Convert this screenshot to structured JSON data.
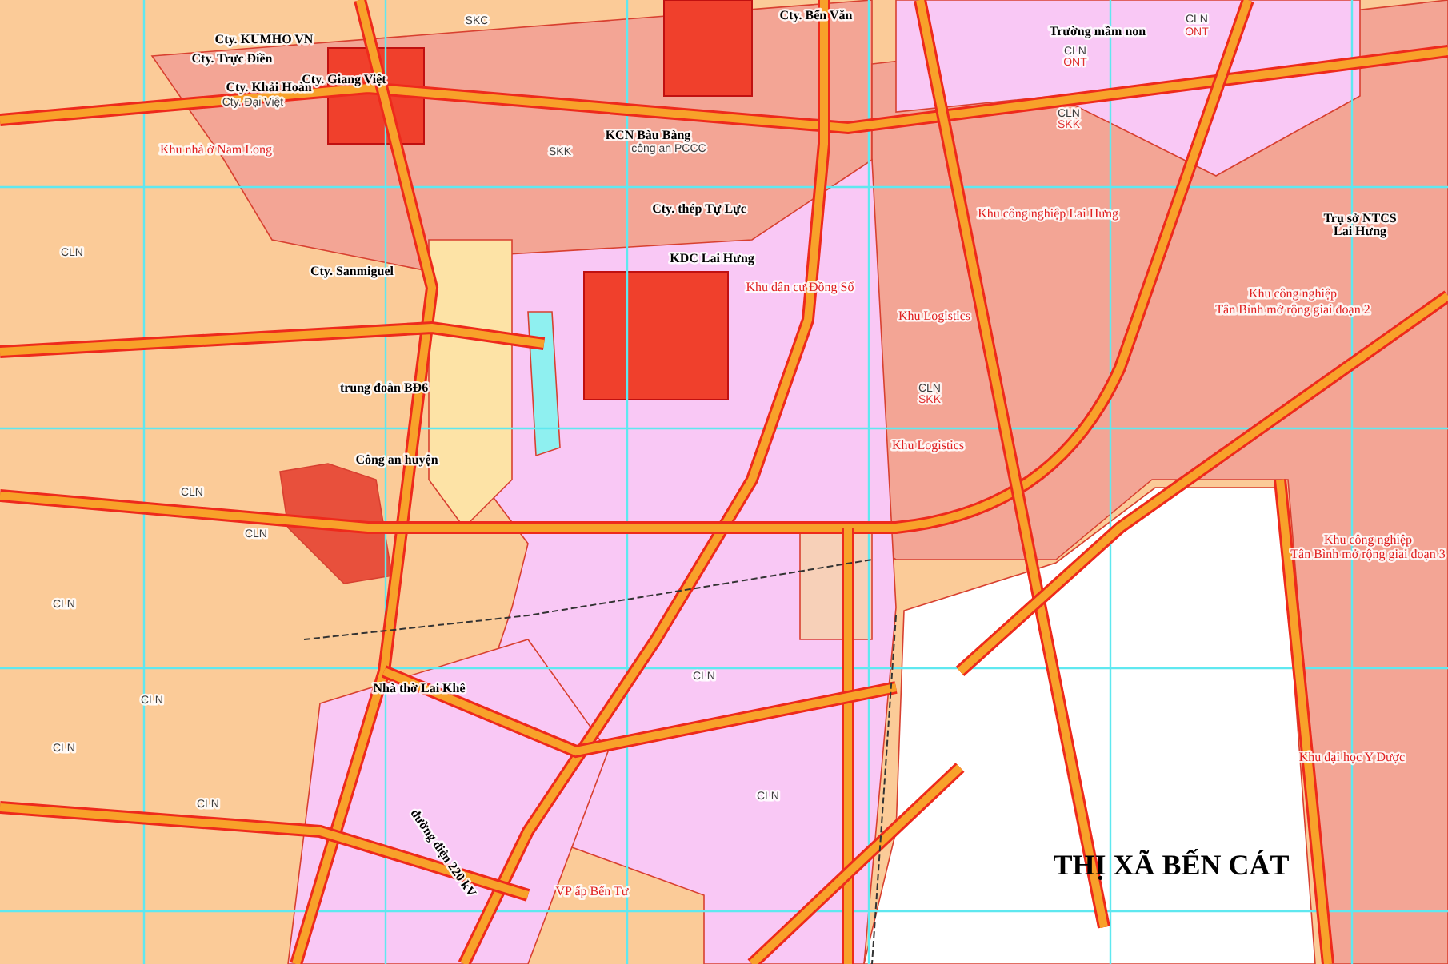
{
  "map": {
    "district_label": "THỊ XÃ BẾN CÁT",
    "labels": [
      {
        "text": "SKC",
        "kind": "code"
      },
      {
        "text": "Cty. Bến Văn",
        "kind": "company"
      },
      {
        "text": "CLN",
        "kind": "code"
      },
      {
        "text": "ONT",
        "kind": "subcode"
      },
      {
        "text": "Trường mầm non",
        "kind": "company"
      },
      {
        "text": "Cty. KUMHO VN",
        "kind": "company"
      },
      {
        "text": "CLN",
        "kind": "code"
      },
      {
        "text": "ONT",
        "kind": "subcode"
      },
      {
        "text": "Cty. Trực Điền",
        "kind": "company"
      },
      {
        "text": "Cty. Giang Việt",
        "kind": "company"
      },
      {
        "text": "Cty. Khải Hoàn",
        "kind": "company"
      },
      {
        "text": "Cty. Đại Việt",
        "kind": "code"
      },
      {
        "text": "CLN",
        "kind": "code"
      },
      {
        "text": "SKK",
        "kind": "subcode"
      },
      {
        "text": "KCN Bàu Bàng",
        "kind": "company"
      },
      {
        "text": "Khu nhà ở Nam Long",
        "kind": "area"
      },
      {
        "text": "SKK",
        "kind": "code"
      },
      {
        "text": "công an PCCC",
        "kind": "code"
      },
      {
        "text": "Cty. thép Tự Lực",
        "kind": "company"
      },
      {
        "text": "Khu công nghiệp Lai Hưng",
        "kind": "area"
      },
      {
        "text": "Trụ sở NTCS",
        "kind": "company"
      },
      {
        "text": "Lai Hưng",
        "kind": "company"
      },
      {
        "text": "CLN",
        "kind": "code"
      },
      {
        "text": "KDC Lai Hưng",
        "kind": "company"
      },
      {
        "text": "Cty. Sanmiguel",
        "kind": "company"
      },
      {
        "text": "Khu dân cư Đồng Sổ",
        "kind": "area"
      },
      {
        "text": "Khu công nghiệp",
        "kind": "area"
      },
      {
        "text": "Tân Bình mở rộng giai đoạn 2",
        "kind": "area"
      },
      {
        "text": "Khu Logistics",
        "kind": "area"
      },
      {
        "text": "trung đoàn BĐ6",
        "kind": "company"
      },
      {
        "text": "CLN",
        "kind": "code"
      },
      {
        "text": "SKK",
        "kind": "subcode"
      },
      {
        "text": "Khu Logistics",
        "kind": "area"
      },
      {
        "text": "Công an huyện",
        "kind": "company"
      },
      {
        "text": "CLN",
        "kind": "code"
      },
      {
        "text": "CLN",
        "kind": "code"
      },
      {
        "text": "Khu công nghiệp",
        "kind": "area"
      },
      {
        "text": "Tân Bình mở rộng giai đoạn 3",
        "kind": "area"
      },
      {
        "text": "CLN",
        "kind": "code"
      },
      {
        "text": "CLN",
        "kind": "code"
      },
      {
        "text": "Nhà thờ Lai Khê",
        "kind": "company"
      },
      {
        "text": "CLN",
        "kind": "code"
      },
      {
        "text": "CLN",
        "kind": "code"
      },
      {
        "text": "Khu đại học Y Dược",
        "kind": "area"
      },
      {
        "text": "CLN",
        "kind": "code"
      },
      {
        "text": "CLN",
        "kind": "code"
      },
      {
        "text": "đường điện 220 kV",
        "kind": "line"
      },
      {
        "text": "VP ấp Bến Tư",
        "kind": "area"
      }
    ]
  }
}
